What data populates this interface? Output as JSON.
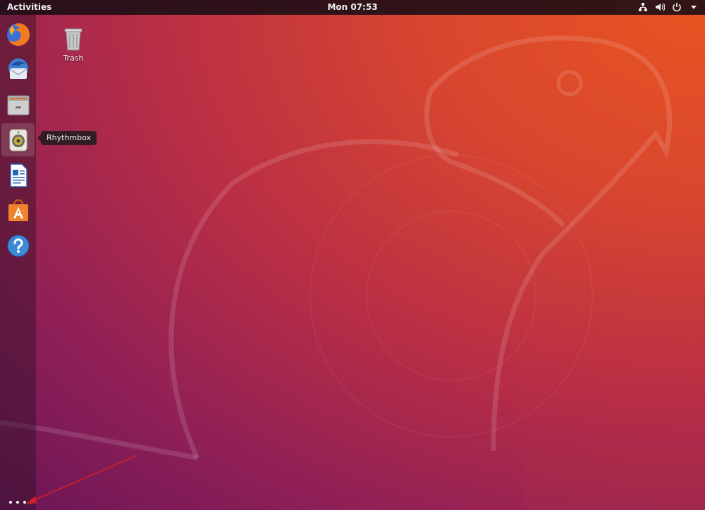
{
  "topbar": {
    "activities_label": "Activities",
    "clock": "Mon 07:53",
    "tray": {
      "network_icon": "network-wired-icon",
      "volume_icon": "volume-icon",
      "power_icon": "power-icon",
      "menu_icon": "chevron-down-icon"
    }
  },
  "dock": {
    "items": [
      {
        "name": "Firefox",
        "icon": "firefox-icon"
      },
      {
        "name": "Thunderbird",
        "icon": "thunderbird-icon"
      },
      {
        "name": "Files",
        "icon": "files-icon"
      },
      {
        "name": "Rhythmbox",
        "icon": "rhythmbox-icon"
      },
      {
        "name": "LibreOffice Writer",
        "icon": "writer-icon"
      },
      {
        "name": "Ubuntu Software",
        "icon": "software-icon"
      },
      {
        "name": "Help",
        "icon": "help-icon"
      }
    ],
    "tooltip": "Rhythmbox",
    "show_apps_icon": "apps-grid-icon"
  },
  "desktop": {
    "icons": [
      {
        "label": "Trash",
        "icon": "trash-icon"
      }
    ]
  },
  "colors": {
    "accent": "#e95420",
    "annotation_arrow": "#d0202a"
  }
}
